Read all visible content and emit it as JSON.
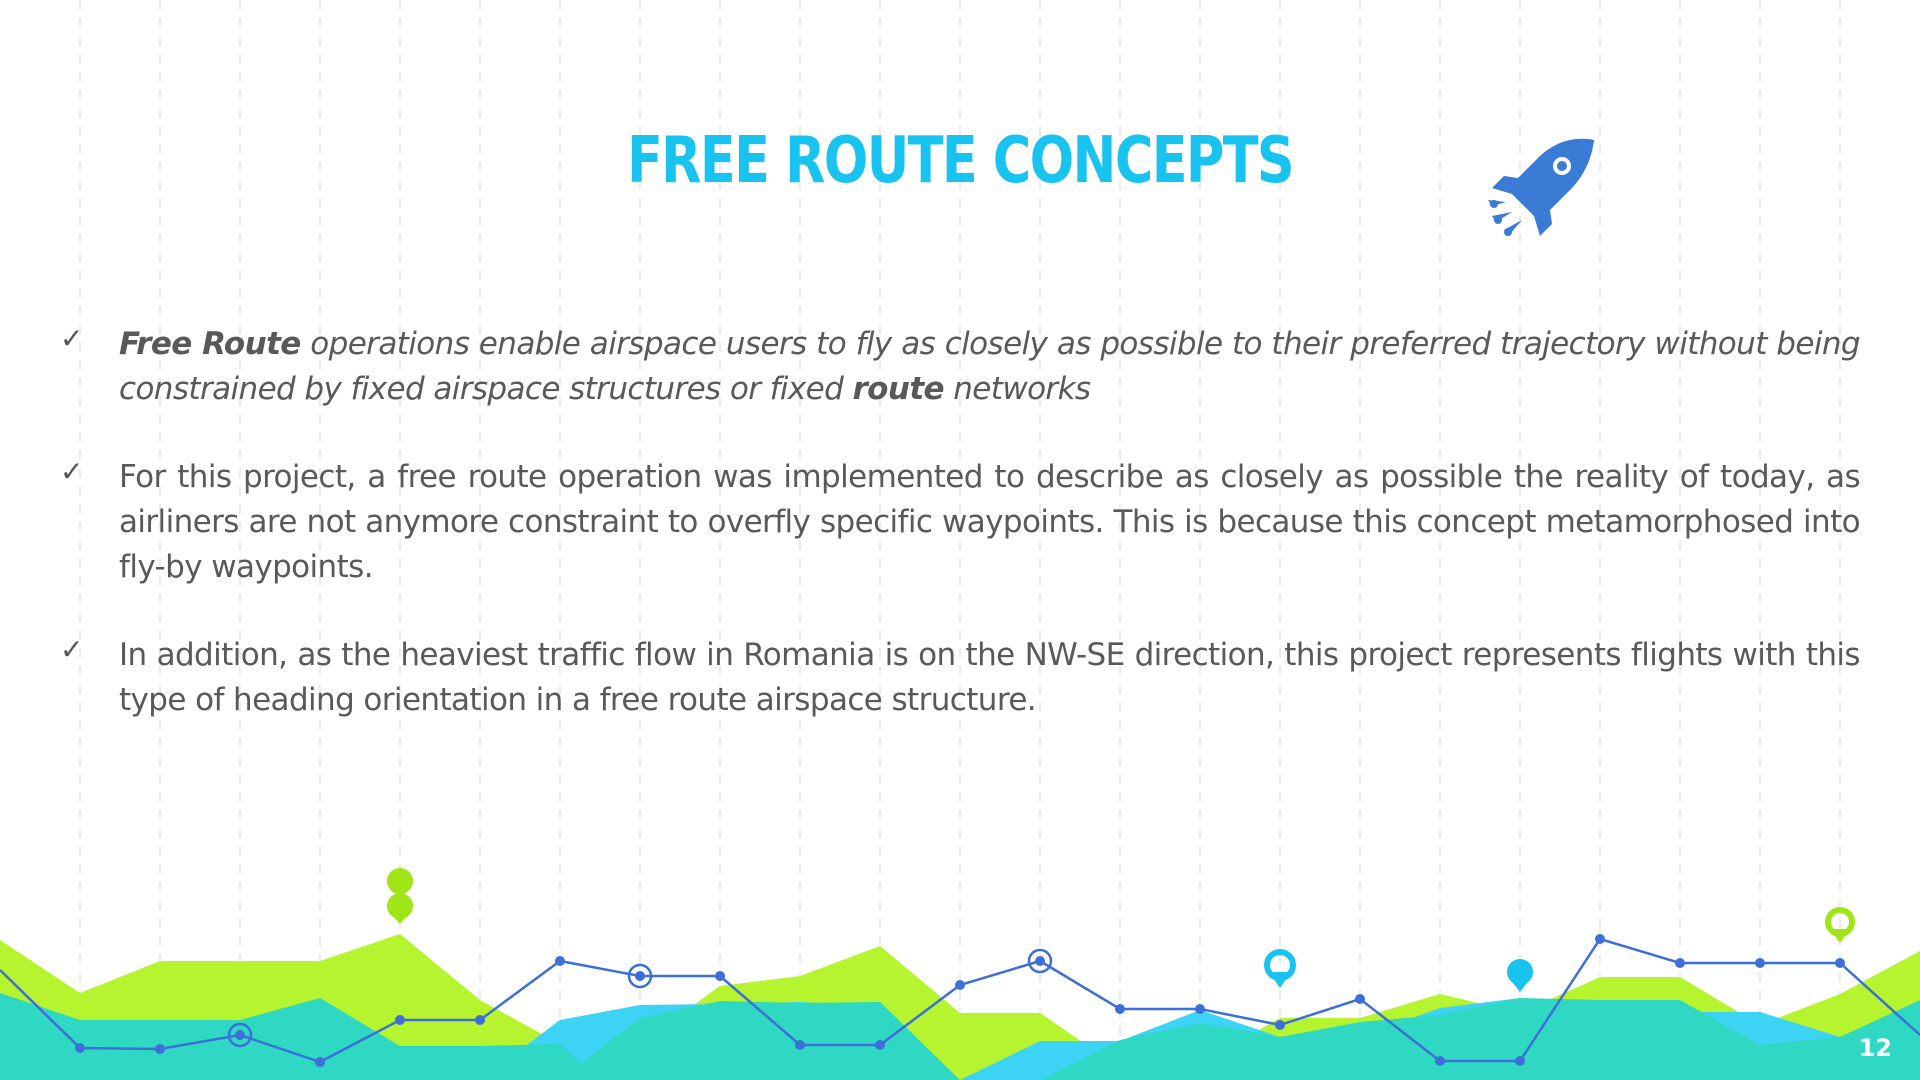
{
  "slide": {
    "title": "FREE ROUTE CONCEPTS",
    "page_number": "12",
    "rocket_icon": "rocket-icon",
    "accent_color": "#19c3ef",
    "rocket_color": "#3a7bd5",
    "bullets": [
      {
        "bold_lead": "Free Route",
        "text_mid": " operations enable airspace users to fly as closely as possible to their preferred trajectory without being constrained by fixed airspace structures or fixed ",
        "bold_word": "route",
        "text_end": " networks"
      },
      {
        "text": "For this project, a free route operation was implemented to describe as closely as possible the reality of today, as airliners are not anymore constraint to overfly specific waypoints. This is because this concept metamorphosed into fly-by waypoints."
      },
      {
        "text": "In addition, as the heaviest traffic flow in Romania is on the NW-SE direction, this project represents flights with this type of heading orientation in a free route airspace structure."
      }
    ],
    "check_icon": "✓",
    "colors": {
      "lime": "#b5f42e",
      "teal": "#2fd8c2",
      "sky": "#3dd3f5",
      "line": "#3d6fd8",
      "pin_cyan": "#19c3ef",
      "pin_lime": "#9fe517"
    }
  }
}
